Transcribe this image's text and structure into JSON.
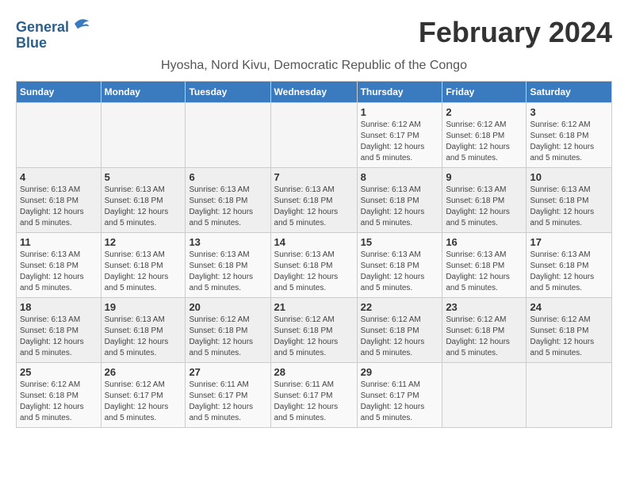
{
  "logo": {
    "line1": "General",
    "line2": "Blue"
  },
  "title": "February 2024",
  "location": "Hyosha, Nord Kivu, Democratic Republic of the Congo",
  "days_of_week": [
    "Sunday",
    "Monday",
    "Tuesday",
    "Wednesday",
    "Thursday",
    "Friday",
    "Saturday"
  ],
  "weeks": [
    [
      {
        "day": "",
        "info": ""
      },
      {
        "day": "",
        "info": ""
      },
      {
        "day": "",
        "info": ""
      },
      {
        "day": "",
        "info": ""
      },
      {
        "day": "1",
        "info": "Sunrise: 6:12 AM\nSunset: 6:17 PM\nDaylight: 12 hours\nand 5 minutes."
      },
      {
        "day": "2",
        "info": "Sunrise: 6:12 AM\nSunset: 6:18 PM\nDaylight: 12 hours\nand 5 minutes."
      },
      {
        "day": "3",
        "info": "Sunrise: 6:12 AM\nSunset: 6:18 PM\nDaylight: 12 hours\nand 5 minutes."
      }
    ],
    [
      {
        "day": "4",
        "info": "Sunrise: 6:13 AM\nSunset: 6:18 PM\nDaylight: 12 hours\nand 5 minutes."
      },
      {
        "day": "5",
        "info": "Sunrise: 6:13 AM\nSunset: 6:18 PM\nDaylight: 12 hours\nand 5 minutes."
      },
      {
        "day": "6",
        "info": "Sunrise: 6:13 AM\nSunset: 6:18 PM\nDaylight: 12 hours\nand 5 minutes."
      },
      {
        "day": "7",
        "info": "Sunrise: 6:13 AM\nSunset: 6:18 PM\nDaylight: 12 hours\nand 5 minutes."
      },
      {
        "day": "8",
        "info": "Sunrise: 6:13 AM\nSunset: 6:18 PM\nDaylight: 12 hours\nand 5 minutes."
      },
      {
        "day": "9",
        "info": "Sunrise: 6:13 AM\nSunset: 6:18 PM\nDaylight: 12 hours\nand 5 minutes."
      },
      {
        "day": "10",
        "info": "Sunrise: 6:13 AM\nSunset: 6:18 PM\nDaylight: 12 hours\nand 5 minutes."
      }
    ],
    [
      {
        "day": "11",
        "info": "Sunrise: 6:13 AM\nSunset: 6:18 PM\nDaylight: 12 hours\nand 5 minutes."
      },
      {
        "day": "12",
        "info": "Sunrise: 6:13 AM\nSunset: 6:18 PM\nDaylight: 12 hours\nand 5 minutes."
      },
      {
        "day": "13",
        "info": "Sunrise: 6:13 AM\nSunset: 6:18 PM\nDaylight: 12 hours\nand 5 minutes."
      },
      {
        "day": "14",
        "info": "Sunrise: 6:13 AM\nSunset: 6:18 PM\nDaylight: 12 hours\nand 5 minutes."
      },
      {
        "day": "15",
        "info": "Sunrise: 6:13 AM\nSunset: 6:18 PM\nDaylight: 12 hours\nand 5 minutes."
      },
      {
        "day": "16",
        "info": "Sunrise: 6:13 AM\nSunset: 6:18 PM\nDaylight: 12 hours\nand 5 minutes."
      },
      {
        "day": "17",
        "info": "Sunrise: 6:13 AM\nSunset: 6:18 PM\nDaylight: 12 hours\nand 5 minutes."
      }
    ],
    [
      {
        "day": "18",
        "info": "Sunrise: 6:13 AM\nSunset: 6:18 PM\nDaylight: 12 hours\nand 5 minutes."
      },
      {
        "day": "19",
        "info": "Sunrise: 6:13 AM\nSunset: 6:18 PM\nDaylight: 12 hours\nand 5 minutes."
      },
      {
        "day": "20",
        "info": "Sunrise: 6:12 AM\nSunset: 6:18 PM\nDaylight: 12 hours\nand 5 minutes."
      },
      {
        "day": "21",
        "info": "Sunrise: 6:12 AM\nSunset: 6:18 PM\nDaylight: 12 hours\nand 5 minutes."
      },
      {
        "day": "22",
        "info": "Sunrise: 6:12 AM\nSunset: 6:18 PM\nDaylight: 12 hours\nand 5 minutes."
      },
      {
        "day": "23",
        "info": "Sunrise: 6:12 AM\nSunset: 6:18 PM\nDaylight: 12 hours\nand 5 minutes."
      },
      {
        "day": "24",
        "info": "Sunrise: 6:12 AM\nSunset: 6:18 PM\nDaylight: 12 hours\nand 5 minutes."
      }
    ],
    [
      {
        "day": "25",
        "info": "Sunrise: 6:12 AM\nSunset: 6:18 PM\nDaylight: 12 hours\nand 5 minutes."
      },
      {
        "day": "26",
        "info": "Sunrise: 6:12 AM\nSunset: 6:17 PM\nDaylight: 12 hours\nand 5 minutes."
      },
      {
        "day": "27",
        "info": "Sunrise: 6:11 AM\nSunset: 6:17 PM\nDaylight: 12 hours\nand 5 minutes."
      },
      {
        "day": "28",
        "info": "Sunrise: 6:11 AM\nSunset: 6:17 PM\nDaylight: 12 hours\nand 5 minutes."
      },
      {
        "day": "29",
        "info": "Sunrise: 6:11 AM\nSunset: 6:17 PM\nDaylight: 12 hours\nand 5 minutes."
      },
      {
        "day": "",
        "info": ""
      },
      {
        "day": "",
        "info": ""
      }
    ]
  ]
}
